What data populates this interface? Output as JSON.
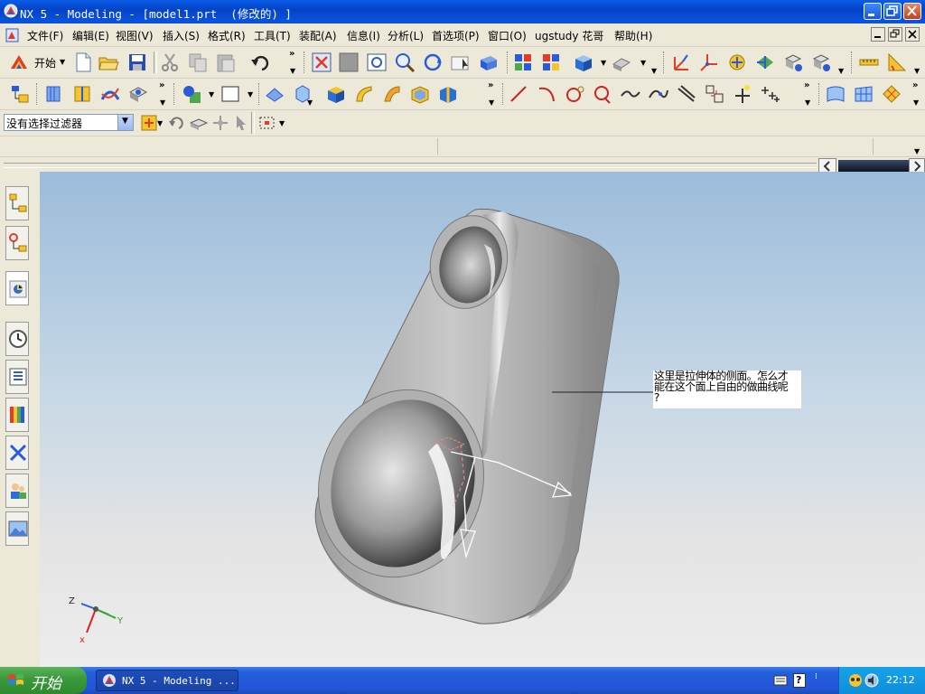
{
  "window": {
    "title": "NX 5 - Modeling - [model1.prt  (修改的) ]"
  },
  "menu": {
    "items": [
      "文件(F)",
      "编辑(E)",
      "视图(V)",
      "插入(S)",
      "格式(R)",
      "工具(T)",
      "装配(A)",
      "信息(I)",
      "分析(L)",
      "首选项(P)",
      "窗口(O)",
      "ugstudy 花哥",
      "帮助(H)"
    ]
  },
  "toolbar": {
    "start_label": "开始"
  },
  "filter": {
    "value": "没有选择过滤器"
  },
  "annotation": {
    "text_line1": "这里是拉伸体的侧面。怎么才",
    "text_line2": "能在这个面上自由的做曲线呢",
    "text_line3": "?"
  },
  "triad": {
    "x_label": "x",
    "y_label": "Y",
    "z_label": "Z"
  },
  "taskbar": {
    "start_label": "开始",
    "task_label": "NX 5 - Modeling ...",
    "clock": "22:12"
  },
  "colors": {
    "titlebar": "#0A5DE8",
    "viewport_top": "#9CBCDA",
    "viewport_bottom": "#EDEDED",
    "taskbar": "#245EDB",
    "start_button": "#3C9A3C"
  }
}
